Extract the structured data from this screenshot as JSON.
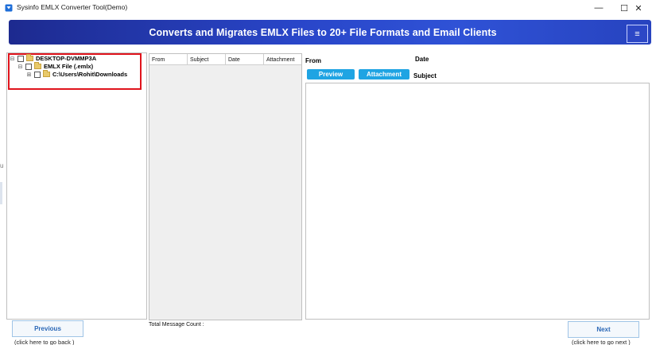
{
  "window": {
    "title": "Sysinfo EMLX Converter Tool(Demo)",
    "min_glyph": "—",
    "max_glyph": "☐",
    "close_glyph": "✕"
  },
  "banner": {
    "text": "Converts and Migrates EMLX Files to 20+ File Formats and Email Clients",
    "menu_glyph": "≡"
  },
  "left_edge": {
    "mark": "u"
  },
  "tree": {
    "items": [
      {
        "label": "DESKTOP-DVMMP3A",
        "expander": "⊟"
      },
      {
        "label": "EMLX File (.emlx)",
        "expander": "⊟"
      },
      {
        "label": "C:\\Users\\Rohit\\Downloads",
        "expander": "⊞"
      }
    ]
  },
  "message_list": {
    "columns": [
      "From",
      "Subject",
      "Date",
      "Attachment"
    ],
    "total_label": "Total Message Count :"
  },
  "preview": {
    "from_label": "From",
    "date_label": "Date",
    "subject_label": "Subject",
    "preview_button": "Preview",
    "attachment_button": "Attachment"
  },
  "nav": {
    "previous_label": "Previous",
    "previous_hint": "(click here to  go back )",
    "next_label": "Next",
    "next_hint": "(click here to  go next )"
  },
  "colors": {
    "banner_start": "#1d2a8f",
    "banner_end": "#2f52d6",
    "button_blue": "#1fa4e3",
    "highlight_red": "#e0141c",
    "nav_text": "#2a67b6"
  }
}
